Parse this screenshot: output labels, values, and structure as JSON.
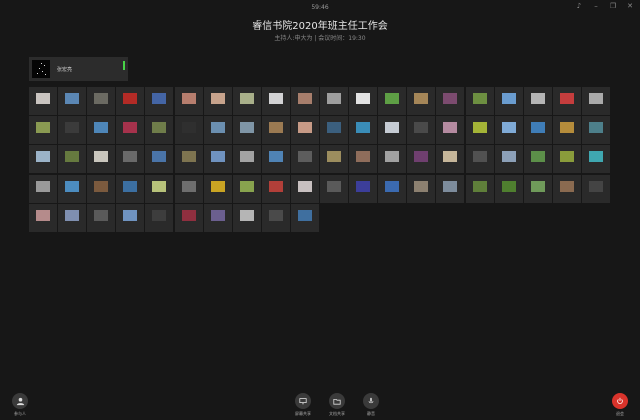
{
  "window": {
    "clock": "59:46"
  },
  "meeting": {
    "title": "睿信书院2020年班主任工作会",
    "subtitle": "主持人:申大为 | 会议时间：19:30"
  },
  "speaker": {
    "name": "张宏亮"
  },
  "participants": [
    {
      "name": "",
      "color": "#c9c4c0"
    },
    {
      "name": "",
      "color": "#5b87b4"
    },
    {
      "name": "",
      "color": "#6b6a62"
    },
    {
      "name": "",
      "color": "#b32b26"
    },
    {
      "name": "",
      "color": "#4465a5"
    },
    {
      "name": "",
      "color": "#b77e6e"
    },
    {
      "name": "",
      "color": "#c7a38c"
    },
    {
      "name": "",
      "color": "#a9b08a"
    },
    {
      "name": "",
      "color": "#d2d2d4"
    },
    {
      "name": "",
      "color": "#a77e6c"
    },
    {
      "name": "",
      "color": "#9e9e9e"
    },
    {
      "name": "",
      "color": "#e2e2e2"
    },
    {
      "name": "",
      "color": "#5e9f45"
    },
    {
      "name": "",
      "color": "#a58658"
    },
    {
      "name": "",
      "color": "#7c4b6f"
    },
    {
      "name": "",
      "color": "#6d8f41"
    },
    {
      "name": "",
      "color": "#6a9ccf"
    },
    {
      "name": "",
      "color": "#b5b5b5"
    },
    {
      "name": "",
      "color": "#c53d3d"
    },
    {
      "name": "",
      "color": "#aaaaaa"
    },
    {
      "name": "",
      "color": "#8a9a52"
    },
    {
      "name": "",
      "color": "#3b3b3b"
    },
    {
      "name": "",
      "color": "#4e86b8"
    },
    {
      "name": "",
      "color": "#a6324c"
    },
    {
      "name": "",
      "color": "#6f7d4a"
    },
    {
      "name": "",
      "color": "#2f2f2f"
    },
    {
      "name": "",
      "color": "#6b8fb0"
    },
    {
      "name": "",
      "color": "#7f95a6"
    },
    {
      "name": "",
      "color": "#9b7a52"
    },
    {
      "name": "",
      "color": "#c79a86"
    },
    {
      "name": "",
      "color": "#3b5f7e"
    },
    {
      "name": "",
      "color": "#3a8db8"
    },
    {
      "name": "",
      "color": "#c5cbd3"
    },
    {
      "name": "",
      "color": "#4a4a4a"
    },
    {
      "name": "",
      "color": "#b48aa0"
    },
    {
      "name": "",
      "color": "#a4b437"
    },
    {
      "name": "",
      "color": "#7faad6"
    },
    {
      "name": "",
      "color": "#3f7db7"
    },
    {
      "name": "",
      "color": "#b58c3b"
    },
    {
      "name": "",
      "color": "#4d7f8a"
    },
    {
      "name": "",
      "color": "#9bb3c8"
    },
    {
      "name": "",
      "color": "#667a3f"
    },
    {
      "name": "",
      "color": "#c9c6bd"
    },
    {
      "name": "",
      "color": "#6a6a6a"
    },
    {
      "name": "",
      "color": "#4a74a8"
    },
    {
      "name": "",
      "color": "#7e7450"
    },
    {
      "name": "",
      "color": "#6f92bf"
    },
    {
      "name": "",
      "color": "#a3a3a3"
    },
    {
      "name": "",
      "color": "#4f83b5"
    },
    {
      "name": "",
      "color": "#5d5d5d"
    },
    {
      "name": "",
      "color": "#9c8d5e"
    },
    {
      "name": "",
      "color": "#8f6d5b"
    },
    {
      "name": "",
      "color": "#a1a1a1"
    },
    {
      "name": "",
      "color": "#6f3f6f"
    },
    {
      "name": "",
      "color": "#c6b69a"
    },
    {
      "name": "",
      "color": "#515151"
    },
    {
      "name": "",
      "color": "#8ca0b8"
    },
    {
      "name": "",
      "color": "#5c8f49"
    },
    {
      "name": "",
      "color": "#8a9c3b"
    },
    {
      "name": "",
      "color": "#3fa7b0"
    },
    {
      "name": "",
      "color": "#9a9a9a"
    },
    {
      "name": "",
      "color": "#4c8cbf"
    },
    {
      "name": "",
      "color": "#7b5a3e"
    },
    {
      "name": "",
      "color": "#3c6fa1"
    },
    {
      "name": "",
      "color": "#b7c27a"
    },
    {
      "name": "",
      "color": "#6e6e6e"
    },
    {
      "name": "",
      "color": "#c9a423"
    },
    {
      "name": "",
      "color": "#88a34e"
    },
    {
      "name": "",
      "color": "#b23f39"
    },
    {
      "name": "",
      "color": "#c8c0c0"
    },
    {
      "name": "",
      "color": "#5a5a5a"
    },
    {
      "name": "",
      "color": "#3c3e9a"
    },
    {
      "name": "",
      "color": "#3b6ab0"
    },
    {
      "name": "",
      "color": "#8c8070"
    },
    {
      "name": "",
      "color": "#7d8c9c"
    },
    {
      "name": "",
      "color": "#5f7f3a"
    },
    {
      "name": "",
      "color": "#4f7f2f"
    },
    {
      "name": "",
      "color": "#6f9a5a"
    },
    {
      "name": "",
      "color": "#8a6a50"
    },
    {
      "name": "",
      "color": "#444444"
    },
    {
      "name": "",
      "color": "#b58b8b"
    },
    {
      "name": "",
      "color": "#7f8fb0"
    },
    {
      "name": "",
      "color": "#5a5a5a"
    },
    {
      "name": "",
      "color": "#6f93c0"
    },
    {
      "name": "",
      "color": "#3d3d3d"
    },
    {
      "name": "",
      "color": "#8f2f3f"
    },
    {
      "name": "",
      "color": "#6b5f8f"
    },
    {
      "name": "",
      "color": "#b5b5b5"
    },
    {
      "name": "",
      "color": "#4a4a4a"
    },
    {
      "name": "",
      "color": "#3f6f9f"
    }
  ],
  "controls": {
    "participants_label": "参与人",
    "screen_share_label": "屏幕共享",
    "doc_share_label": "文档共享",
    "mic_label": "静音",
    "leave_label": "退会"
  },
  "colors": {
    "leave": "#d9332b",
    "mic_active": "#47d447"
  }
}
